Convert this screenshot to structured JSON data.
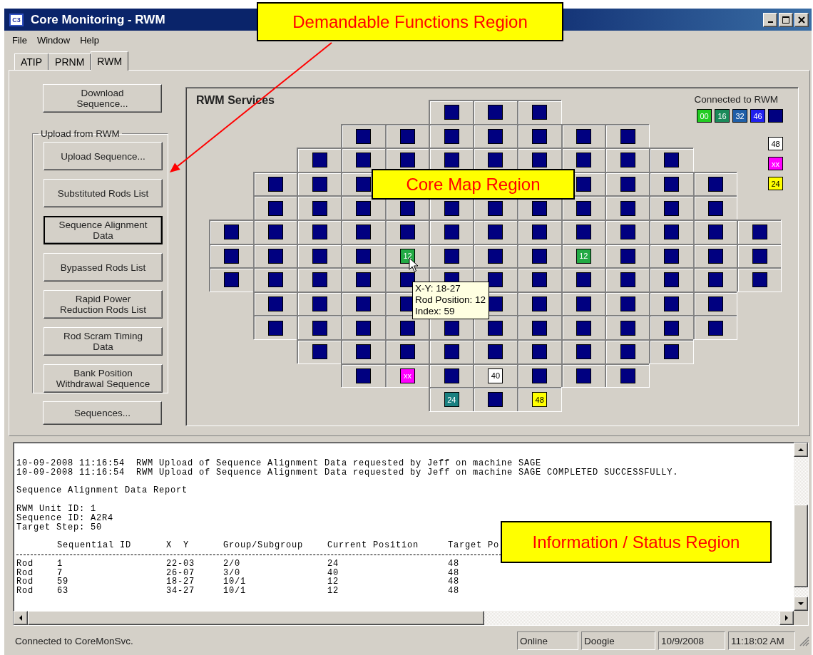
{
  "window": {
    "icon_label": "C3",
    "title": "Core Monitoring - RWM"
  },
  "menu": [
    "File",
    "Window",
    "Help"
  ],
  "tabs": [
    {
      "label": "ATIP",
      "selected": false
    },
    {
      "label": "PRNM",
      "selected": false
    },
    {
      "label": "RWM",
      "selected": true
    }
  ],
  "functions": {
    "top": [
      {
        "label": "Download\nSequence...",
        "focused": false
      }
    ],
    "group": {
      "title": "Upload from RWM",
      "buttons": [
        {
          "label": "Upload Sequence...",
          "focused": false
        },
        {
          "label": "Substituted Rods List",
          "focused": false
        },
        {
          "label": "Sequence Alignment\nData",
          "focused": true
        },
        {
          "label": "Bypassed Rods List",
          "focused": false
        },
        {
          "label": "Rapid Power\nReduction Rods List",
          "focused": false
        },
        {
          "label": "Rod Scram Timing\nData",
          "focused": false
        },
        {
          "label": "Bank Position\nWithdrawal Sequence",
          "focused": false
        }
      ]
    },
    "bottom": [
      {
        "label": "Sequences...",
        "focused": false
      }
    ]
  },
  "core_map": {
    "title": "RWM Services",
    "legend": {
      "title": "Connected to RWM",
      "chips": [
        {
          "label": "00",
          "color": "#22cc22"
        },
        {
          "label": "16",
          "color": "#1a8a5a"
        },
        {
          "label": "32",
          "color": "#1f5fa8"
        },
        {
          "label": "46",
          "color": "#2020ee"
        },
        {
          "color": "#000080"
        }
      ],
      "side_chips": [
        {
          "label": "48",
          "color": "#ffffff"
        },
        {
          "label": "xx",
          "color": "#ff00ff"
        },
        {
          "label": "24",
          "color": "#ffff00"
        }
      ]
    },
    "rows": [
      [
        {
          "kind": "empty"
        },
        {
          "kind": "empty"
        },
        {
          "kind": "empty"
        },
        {
          "kind": "empty"
        },
        {
          "kind": "empty"
        },
        {
          "kind": "rod",
          "color": "#000080"
        },
        {
          "kind": "rod",
          "color": "#000080"
        },
        {
          "kind": "rod",
          "color": "#000080"
        },
        {
          "kind": "empty"
        },
        {
          "kind": "empty"
        },
        {
          "kind": "empty"
        },
        {
          "kind": "empty"
        },
        {
          "kind": "empty"
        }
      ],
      [
        {
          "kind": "empty"
        },
        {
          "kind": "empty"
        },
        {
          "kind": "empty"
        },
        {
          "kind": "rod",
          "color": "#000080"
        },
        {
          "kind": "rod",
          "color": "#000080"
        },
        {
          "kind": "rod",
          "color": "#000080"
        },
        {
          "kind": "rod",
          "color": "#000080"
        },
        {
          "kind": "rod",
          "color": "#000080"
        },
        {
          "kind": "rod",
          "color": "#000080"
        },
        {
          "kind": "rod",
          "color": "#000080"
        },
        {
          "kind": "empty"
        },
        {
          "kind": "empty"
        },
        {
          "kind": "empty"
        }
      ],
      [
        {
          "kind": "empty"
        },
        {
          "kind": "empty"
        },
        {
          "kind": "rod",
          "color": "#000080"
        },
        {
          "kind": "rod",
          "color": "#000080"
        },
        {
          "kind": "rod",
          "color": "#000080"
        },
        {
          "kind": "rod",
          "color": "#000080"
        },
        {
          "kind": "rod",
          "color": "#000080"
        },
        {
          "kind": "rod",
          "color": "#000080"
        },
        {
          "kind": "rod",
          "color": "#000080"
        },
        {
          "kind": "rod",
          "color": "#000080"
        },
        {
          "kind": "rod",
          "color": "#000080"
        },
        {
          "kind": "empty"
        },
        {
          "kind": "empty"
        }
      ],
      [
        {
          "kind": "empty"
        },
        {
          "kind": "rod",
          "color": "#000080"
        },
        {
          "kind": "rod",
          "color": "#000080"
        },
        {
          "kind": "rod",
          "color": "#000080"
        },
        {
          "kind": "covered"
        },
        {
          "kind": "covered"
        },
        {
          "kind": "covered"
        },
        {
          "kind": "covered"
        },
        {
          "kind": "rod",
          "color": "#000080"
        },
        {
          "kind": "rod",
          "color": "#000080"
        },
        {
          "kind": "rod",
          "color": "#000080"
        },
        {
          "kind": "rod",
          "color": "#000080"
        },
        {
          "kind": "empty"
        }
      ],
      [
        {
          "kind": "empty"
        },
        {
          "kind": "rod",
          "color": "#000080"
        },
        {
          "kind": "rod",
          "color": "#000080"
        },
        {
          "kind": "rod",
          "color": "#000080"
        },
        {
          "kind": "rod",
          "color": "#000080"
        },
        {
          "kind": "rod",
          "color": "#000080"
        },
        {
          "kind": "rod",
          "color": "#000080"
        },
        {
          "kind": "rod",
          "color": "#000080"
        },
        {
          "kind": "rod",
          "color": "#000080"
        },
        {
          "kind": "rod",
          "color": "#000080"
        },
        {
          "kind": "rod",
          "color": "#000080"
        },
        {
          "kind": "rod",
          "color": "#000080"
        },
        {
          "kind": "empty"
        }
      ],
      [
        {
          "kind": "rod",
          "color": "#000080"
        },
        {
          "kind": "rod",
          "color": "#000080"
        },
        {
          "kind": "rod",
          "color": "#000080"
        },
        {
          "kind": "rod",
          "color": "#000080"
        },
        {
          "kind": "rod",
          "color": "#000080"
        },
        {
          "kind": "rod",
          "color": "#000080"
        },
        {
          "kind": "rod",
          "color": "#000080"
        },
        {
          "kind": "rod",
          "color": "#000080"
        },
        {
          "kind": "rod",
          "color": "#000080"
        },
        {
          "kind": "rod",
          "color": "#000080"
        },
        {
          "kind": "rod",
          "color": "#000080"
        },
        {
          "kind": "rod",
          "color": "#000080"
        },
        {
          "kind": "rod",
          "color": "#000080"
        }
      ],
      [
        {
          "kind": "rod",
          "color": "#000080"
        },
        {
          "kind": "rod",
          "color": "#000080"
        },
        {
          "kind": "rod",
          "color": "#000080"
        },
        {
          "kind": "rod",
          "color": "#000080"
        },
        {
          "kind": "rod",
          "color": "#22aa44",
          "label": "12"
        },
        {
          "kind": "rod",
          "color": "#000080"
        },
        {
          "kind": "rod",
          "color": "#000080"
        },
        {
          "kind": "rod",
          "color": "#000080"
        },
        {
          "kind": "rod",
          "color": "#22aa44",
          "label": "12"
        },
        {
          "kind": "rod",
          "color": "#000080"
        },
        {
          "kind": "rod",
          "color": "#000080"
        },
        {
          "kind": "rod",
          "color": "#000080"
        },
        {
          "kind": "rod",
          "color": "#000080"
        }
      ],
      [
        {
          "kind": "rod",
          "color": "#000080"
        },
        {
          "kind": "rod",
          "color": "#000080"
        },
        {
          "kind": "rod",
          "color": "#000080"
        },
        {
          "kind": "rod",
          "color": "#000080"
        },
        {
          "kind": "rod",
          "color": "#000080"
        },
        {
          "kind": "rod",
          "color": "#000080"
        },
        {
          "kind": "rod",
          "color": "#000080"
        },
        {
          "kind": "rod",
          "color": "#000080"
        },
        {
          "kind": "rod",
          "color": "#000080"
        },
        {
          "kind": "rod",
          "color": "#000080"
        },
        {
          "kind": "rod",
          "color": "#000080"
        },
        {
          "kind": "rod",
          "color": "#000080"
        },
        {
          "kind": "rod",
          "color": "#000080"
        }
      ],
      [
        {
          "kind": "empty"
        },
        {
          "kind": "rod",
          "color": "#000080"
        },
        {
          "kind": "rod",
          "color": "#000080"
        },
        {
          "kind": "rod",
          "color": "#000080"
        },
        {
          "kind": "rod",
          "color": "#000080"
        },
        {
          "kind": "covered"
        },
        {
          "kind": "rod",
          "color": "#000080"
        },
        {
          "kind": "rod",
          "color": "#000080"
        },
        {
          "kind": "rod",
          "color": "#000080"
        },
        {
          "kind": "rod",
          "color": "#000080"
        },
        {
          "kind": "rod",
          "color": "#000080"
        },
        {
          "kind": "rod",
          "color": "#000080"
        },
        {
          "kind": "empty"
        }
      ],
      [
        {
          "kind": "empty"
        },
        {
          "kind": "rod",
          "color": "#000080"
        },
        {
          "kind": "rod",
          "color": "#000080"
        },
        {
          "kind": "rod",
          "color": "#000080"
        },
        {
          "kind": "rod",
          "color": "#000080"
        },
        {
          "kind": "rod",
          "color": "#000080"
        },
        {
          "kind": "rod",
          "color": "#000080"
        },
        {
          "kind": "rod",
          "color": "#000080"
        },
        {
          "kind": "rod",
          "color": "#000080"
        },
        {
          "kind": "rod",
          "color": "#000080"
        },
        {
          "kind": "rod",
          "color": "#000080"
        },
        {
          "kind": "rod",
          "color": "#000080"
        },
        {
          "kind": "empty"
        }
      ],
      [
        {
          "kind": "empty"
        },
        {
          "kind": "empty"
        },
        {
          "kind": "rod",
          "color": "#000080"
        },
        {
          "kind": "rod",
          "color": "#000080"
        },
        {
          "kind": "rod",
          "color": "#000080"
        },
        {
          "kind": "rod",
          "color": "#000080"
        },
        {
          "kind": "rod",
          "color": "#000080"
        },
        {
          "kind": "rod",
          "color": "#000080"
        },
        {
          "kind": "rod",
          "color": "#000080"
        },
        {
          "kind": "rod",
          "color": "#000080"
        },
        {
          "kind": "rod",
          "color": "#000080"
        },
        {
          "kind": "empty"
        },
        {
          "kind": "empty"
        }
      ],
      [
        {
          "kind": "empty"
        },
        {
          "kind": "empty"
        },
        {
          "kind": "empty"
        },
        {
          "kind": "rod",
          "color": "#000080"
        },
        {
          "kind": "rod",
          "color": "#ff00ff",
          "label": "xx"
        },
        {
          "kind": "rod",
          "color": "#000080"
        },
        {
          "kind": "rod",
          "color": "#ffffff",
          "label": "40"
        },
        {
          "kind": "rod",
          "color": "#000080"
        },
        {
          "kind": "rod",
          "color": "#000080"
        },
        {
          "kind": "rod",
          "color": "#000080"
        },
        {
          "kind": "empty"
        },
        {
          "kind": "empty"
        },
        {
          "kind": "empty"
        }
      ],
      [
        {
          "kind": "empty"
        },
        {
          "kind": "empty"
        },
        {
          "kind": "empty"
        },
        {
          "kind": "empty"
        },
        {
          "kind": "empty"
        },
        {
          "kind": "rod",
          "color": "#1a8080",
          "label": "24"
        },
        {
          "kind": "rod",
          "color": "#000080"
        },
        {
          "kind": "rod",
          "color": "#ffff00",
          "label": "48"
        },
        {
          "kind": "empty"
        },
        {
          "kind": "empty"
        },
        {
          "kind": "empty"
        },
        {
          "kind": "empty"
        },
        {
          "kind": "empty"
        }
      ]
    ],
    "tooltip": {
      "lines": [
        "X-Y: 18-27",
        "Rod Position: 12",
        "Index: 59"
      ]
    }
  },
  "log": {
    "blocks": [
      [
        "10-09-2008 11:16:54  RWM Upload of Sequence Alignment Data requested by Jeff on machine SAGE",
        "10-09-2008 11:16:54  RWM Upload of Sequence Alignment Data requested by Jeff on machine SAGE COMPLETED SUCCESSFULLY."
      ],
      [
        "Sequence Alignment Data Report"
      ],
      [
        "RWM Unit ID: 1",
        "Sequence ID: A2R4",
        "Target Step: 50"
      ]
    ],
    "table": {
      "columns": [
        "Sequential ID",
        "X  Y",
        "Group/Subgroup",
        "Current Position",
        "Target Po"
      ],
      "rows": [
        {
          "type": "Rod",
          "cells": [
            "1",
            "22-03",
            "2/0",
            "24",
            "48"
          ]
        },
        {
          "type": "Rod",
          "cells": [
            "7",
            "26-07",
            "3/0",
            "40",
            "48"
          ]
        },
        {
          "type": "Rod",
          "cells": [
            "59",
            "18-27",
            "10/1",
            "12",
            "48"
          ]
        },
        {
          "type": "Rod",
          "cells": [
            "63",
            "34-27",
            "10/1",
            "12",
            "48"
          ]
        }
      ]
    }
  },
  "status_bar": {
    "message": "Connected to CoreMonSvc.",
    "panels": [
      "Online",
      "Doogie",
      "10/9/2008",
      "11:18:02 AM"
    ]
  },
  "annotations": [
    {
      "text": "Demandable Functions Region"
    },
    {
      "text": "Core Map Region"
    },
    {
      "text": "Information / Status Region"
    }
  ]
}
